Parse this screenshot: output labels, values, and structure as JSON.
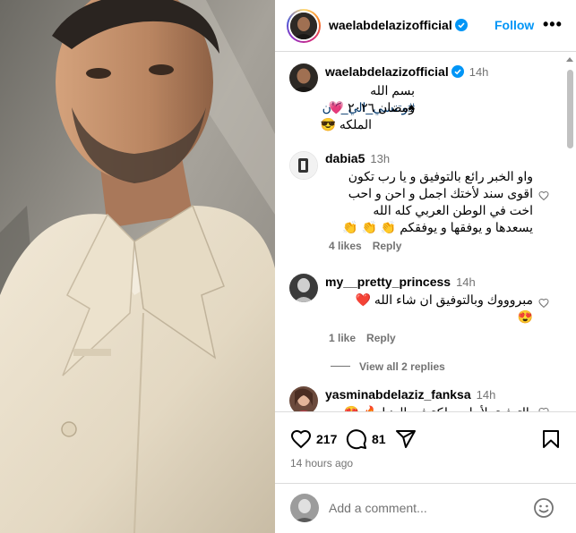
{
  "post": {
    "author": "waelabdelazizofficial",
    "follow_label": "Follow",
    "more_label": "•••",
    "caption": {
      "time": "14h",
      "line1_text": "بسم الله ",
      "line1_hashtag": "#وتنسي_الي_كان",
      "line1_emoji": "♠",
      "line2": "رمضان ٢٠٢٦ 💗",
      "line3": "الملكه 😎"
    }
  },
  "comments": [
    {
      "username": "dabia5",
      "time": "13h",
      "lines": [
        "واو الخبر رائع بالتوفيق و يا رب تكون",
        "اقوى سند لأختك اجمل و احن و احب",
        "اخت في الوطن العربي كله الله",
        "يسعدها و يوفقها و يوفقكم 👏 👏 👏"
      ],
      "likes": "4 likes",
      "reply": "Reply"
    },
    {
      "username": "my__pretty_princess",
      "time": "14h",
      "lines": [
        "مبروووك وبالتوفيق ان شاء الله ❤️",
        "😍"
      ],
      "likes": "1 like",
      "reply": "Reply"
    },
    {
      "username": "yasminabdelaziz_fanksa",
      "time": "14h",
      "lines": [
        "بالتوفيق لأحلى ملكة في الدنيا 🔥 😍"
      ]
    }
  ],
  "view_replies": "View all 2 replies",
  "stats": {
    "likes": "217",
    "comments": "81",
    "timestamp": "14 hours ago"
  },
  "composer": {
    "placeholder": "Add a comment..."
  },
  "icons": {
    "heart": "heart-icon",
    "comment": "comment-icon",
    "share": "share-icon",
    "save": "bookmark-icon",
    "emoji": "smiley-icon",
    "verified": "verified-badge-icon"
  },
  "colors": {
    "follow": "#0095f6",
    "verified": "#0095f6",
    "hashtag": "#00376b",
    "muted": "#737373",
    "heart_red": "#ff3040"
  }
}
